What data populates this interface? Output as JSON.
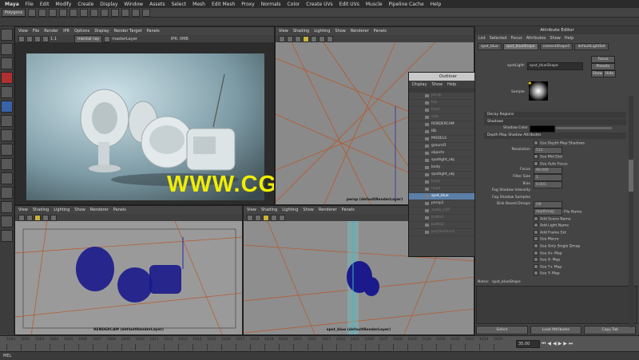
{
  "menubar": {
    "app": "Maya",
    "items": [
      "File",
      "Edit",
      "Modify",
      "Create",
      "Display",
      "Window",
      "Assets",
      "Select",
      "Mesh",
      "Edit Mesh",
      "Proxy",
      "Normals",
      "Color",
      "Create UVs",
      "Edit UVs",
      "Muscle",
      "Pipeline Cache",
      "Help"
    ]
  },
  "statusline": {
    "mode": "Polygons"
  },
  "render_view": {
    "menu": [
      "View",
      "File",
      "Render",
      "IPR",
      "Options",
      "Display",
      "Render Target",
      "Panels"
    ],
    "ratio": "1:1",
    "renderer": "mental ray",
    "layer": "masterLayer",
    "ipr": "IPR: 0MB"
  },
  "persp_top": {
    "menu": [
      "View",
      "Shading",
      "Lighting",
      "Show",
      "Renderer",
      "Panels"
    ],
    "camera_label": "persp (defaultRenderLayer)"
  },
  "renderpane_bottom_left": {
    "menu": [
      "View",
      "Shading",
      "Lighting",
      "Show",
      "Renderer",
      "Panels"
    ],
    "camera_label": "RENDERCAM (defaultRenderLayer)"
  },
  "spot_pane": {
    "menu": [
      "View",
      "Shading",
      "Lighting",
      "Show",
      "Renderer",
      "Panels"
    ],
    "camera_label": "spot_blue (defaultRenderLayer)"
  },
  "outliner": {
    "title": "Outliner",
    "menu": [
      "Display",
      "Show",
      "Help"
    ],
    "items": [
      {
        "label": "persp",
        "state": "dim"
      },
      {
        "label": "top",
        "state": "dim"
      },
      {
        "label": "front",
        "state": "dim"
      },
      {
        "label": "side",
        "state": "dim"
      },
      {
        "label": "RENDERCAM",
        "state": "normal"
      },
      {
        "label": "IBL",
        "state": "normal"
      },
      {
        "label": "MODELS",
        "state": "normal"
      },
      {
        "label": "ground1",
        "state": "normal"
      },
      {
        "label": "objects",
        "state": "normal"
      },
      {
        "label": "spotlight_obj",
        "state": "normal"
      },
      {
        "label": "body",
        "state": "normal"
      },
      {
        "label": "spotlight_obj",
        "state": "normal"
      },
      {
        "label": "body",
        "state": "dim"
      },
      {
        "label": "head",
        "state": "dim"
      },
      {
        "label": "spot_blue",
        "state": "sel"
      },
      {
        "label": "persp1",
        "state": "normal"
      },
      {
        "label": "audio_CRT",
        "state": "dim"
      },
      {
        "label": "bottle1",
        "state": "dim"
      },
      {
        "label": "bottle2",
        "state": "dim"
      },
      {
        "label": "polySurface1",
        "state": "dim"
      }
    ]
  },
  "attribute_editor": {
    "title": "Attribute Editor",
    "menu": [
      "List",
      "Selected",
      "Focus",
      "Attributes",
      "Show",
      "Help"
    ],
    "tabs": [
      "spot_blue",
      "spot_blueShape",
      "cameraShape1",
      "defaultLightSet"
    ],
    "node_label": "spotLight:",
    "node_value": "spot_blueShape",
    "buttons": {
      "focus": "Focus",
      "presets": "Presets",
      "show": "Show",
      "hide": "Hide"
    },
    "sample_label": "Sample",
    "sections": {
      "decay": "Decay Regions",
      "shadows": "Shadows",
      "depth_map": "Depth Map Shadow Attributes"
    },
    "shadow_color_label": "Shadow Color",
    "depth_rows": [
      "Use Depth Map Shadows",
      "Resolution",
      "Use Mid Dist",
      "Use Auto Focus",
      "Focus",
      "Filter Size",
      "Bias",
      "Fog Shadow Intensity",
      "Fog Shadow Samples",
      "Disk Based Dmaps",
      "Shadow Map File Name",
      "Add Scene Name",
      "Add Light Name",
      "Add Frame Ext",
      "Use Macro",
      "Use Only Single Dmap",
      "Use X+ Map",
      "Use X- Map",
      "Use Y+ Map",
      "Use Y- Map"
    ],
    "resolution_value": "512",
    "focus_value": "90.000",
    "filter_value": "1",
    "bias_value": "0.001",
    "disk_dmaps_value": "Off",
    "file_name_value": "depthmap",
    "notes_label": "Notes:",
    "notes_value": "spot_blueShape",
    "footer": [
      "Select",
      "Load Attributes",
      "Copy Tab"
    ]
  },
  "timeline": {
    "ticks": [
      "1001",
      "1002",
      "1003",
      "1004",
      "1005",
      "1006",
      "1007",
      "1008",
      "1009",
      "1010",
      "1011",
      "1012",
      "1013",
      "1014",
      "1015",
      "1016",
      "1017",
      "1018",
      "1019",
      "1020",
      "1021",
      "1022",
      "1023",
      "1024",
      "1025",
      "1026",
      "1027",
      "1028",
      "1029",
      "1030",
      "1031",
      "1032",
      "1033",
      "1034",
      "1035"
    ],
    "current": "35.00"
  },
  "command_line": {
    "label": "MEL"
  },
  "watermark": {
    "text": "WWW.CGTSJ.COM"
  },
  "colors": {
    "accent": "#5b7fa8",
    "watermark": "#f0ee00",
    "wire_blue": "#1a1a8c",
    "wire_orange": "#b8572a"
  }
}
